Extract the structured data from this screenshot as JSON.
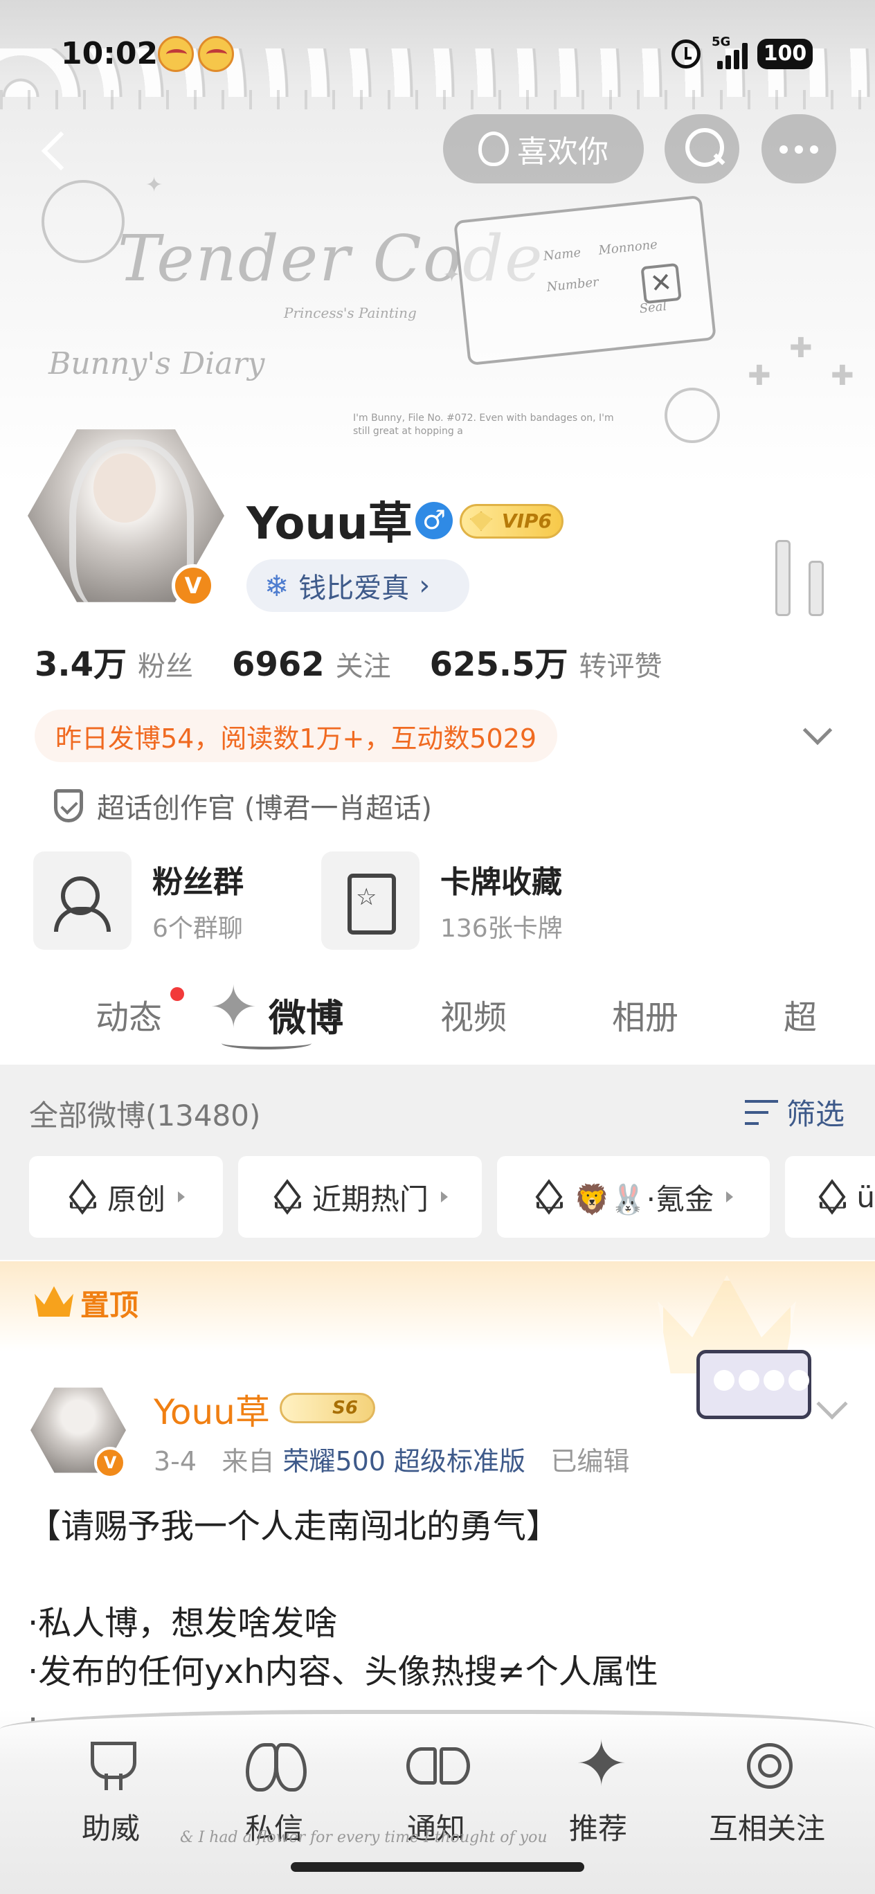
{
  "status_bar": {
    "time": "10:02",
    "network": "5G",
    "battery": "100"
  },
  "header": {
    "like_label": "喜欢你",
    "banner_title": "Tender Code",
    "banner_subtitle": "Bunny's Diary",
    "banner_small": "Princess's Painting",
    "banner_note": "I'm Bunny, File No. #072. Even with bandages on, I'm still great at hopping a",
    "ticket_name": "Name",
    "ticket_number": "Number",
    "ticket_seal": "Seal",
    "ticket_signature": "Monnone"
  },
  "profile": {
    "name": "Youu草",
    "gender_symbol": "♂",
    "vip_label": "VIP6",
    "verified_badge": "V",
    "fan_club": "钱比爱真",
    "stats": [
      {
        "num": "3.4万",
        "label": "粉丝"
      },
      {
        "num": "6962",
        "label": "关注"
      },
      {
        "num": "625.5万",
        "label": "转评赞"
      }
    ],
    "activity": "昨日发博54，阅读数1万+，互动数5029",
    "super_topic": "超话创作官 (博君一肖超话)"
  },
  "cards": [
    {
      "title": "粉丝群",
      "sub": "6个群聊",
      "icon": "group-icon"
    },
    {
      "title": "卡牌收藏",
      "sub": "136张卡牌",
      "icon": "card-icon"
    }
  ],
  "tabs": [
    "动态",
    "微博",
    "视频",
    "相册",
    "超"
  ],
  "feed": {
    "all_count": "全部微博(13480)",
    "filter_label": "筛选",
    "chips": [
      "原创",
      "近期热门",
      "🦁🐰·氪金",
      "ü"
    ]
  },
  "pinned": {
    "label": "置顶"
  },
  "post": {
    "author": "Youu草",
    "level": "S6",
    "verified": "V",
    "date": "3-4",
    "from": "来自",
    "device": "荣耀500 超级标准版",
    "edited": "已编辑",
    "body": "【请赐予我一个人走南闯北的勇气】\n\n·私人博，想发啥发啥\n·发布的任何yxh内容、头像热搜≠个人属性\n·"
  },
  "bottom_nav": [
    "助威",
    "私信",
    "通知",
    "推荐",
    "互相关注"
  ],
  "bottom_cursive": "& I had a flower for every time I thought of you",
  "colors": {
    "accent": "#f07f12",
    "link": "#3e5a8a",
    "gray_bg": "#f0f0f0"
  }
}
